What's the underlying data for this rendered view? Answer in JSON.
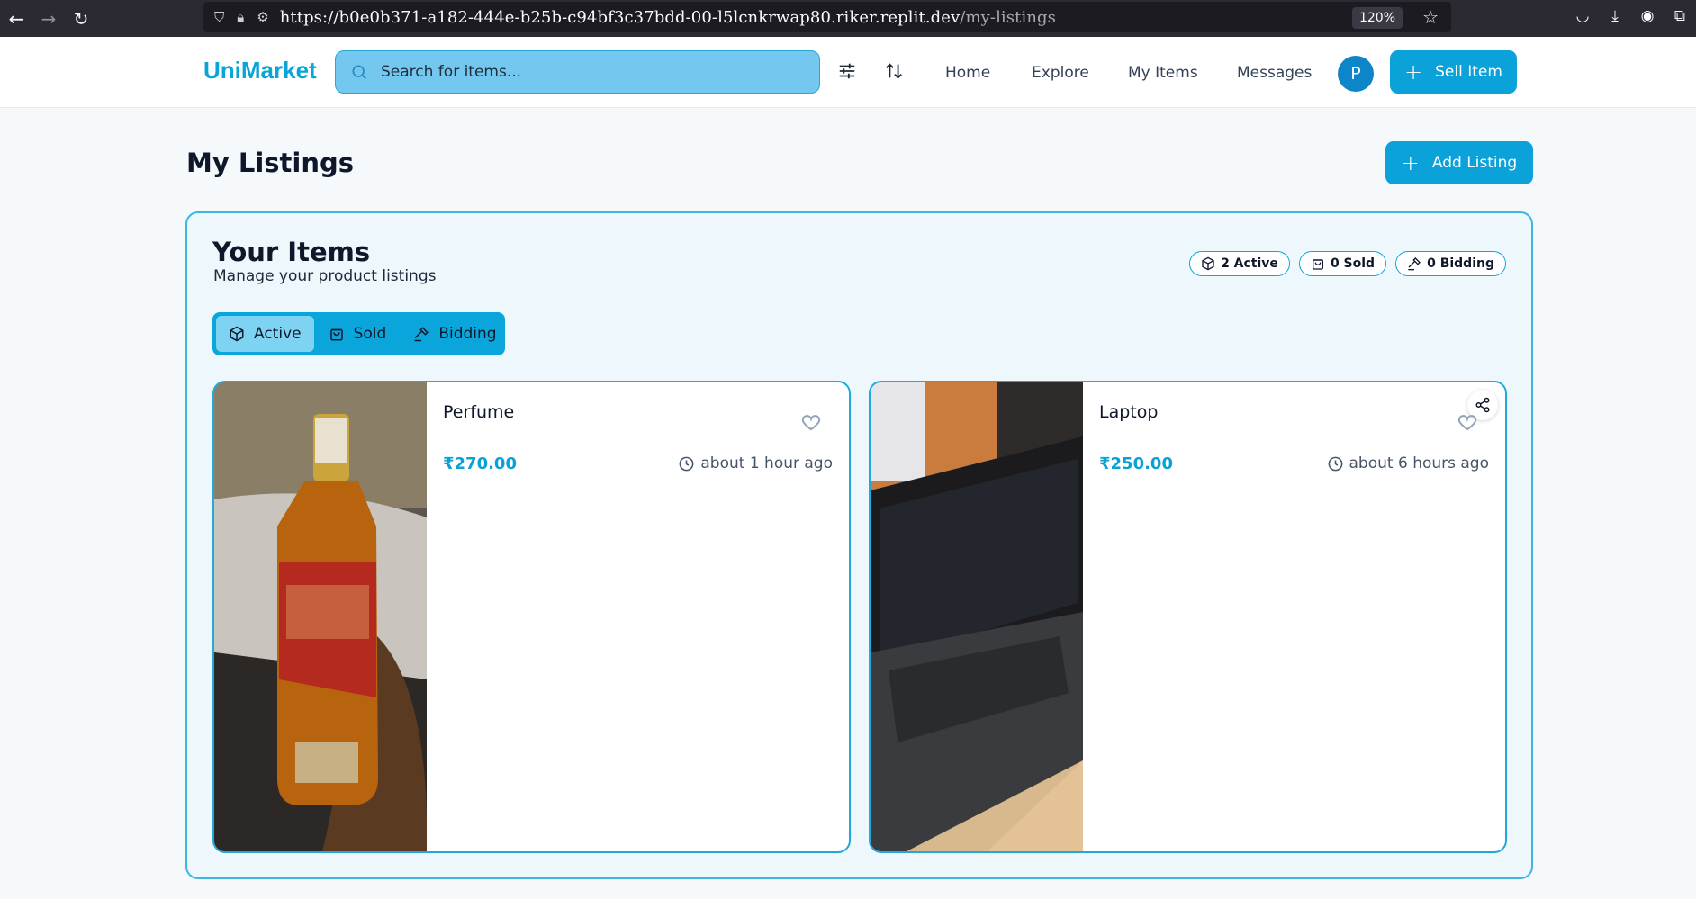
{
  "browser": {
    "url_main": "https://b0e0b371-a182-444e-b25b-c94bf3c37bdd-00-l5lcnkrwap80.riker.replit.dev",
    "url_path": "/my-listings",
    "zoom": "120%"
  },
  "header": {
    "logo": "UniMarket",
    "search_placeholder": "Search for items...",
    "nav": [
      "Home",
      "Explore",
      "My Items",
      "Messages"
    ],
    "avatar_initial": "P",
    "sell_label": "Sell Item"
  },
  "page": {
    "title": "My Listings",
    "add_label": "Add Listing"
  },
  "panel": {
    "title": "Your Items",
    "subtitle": "Manage your product listings",
    "badges": {
      "active": "2 Active",
      "sold": "0 Sold",
      "bidding": "0 Bidding"
    },
    "tabs": {
      "active": "Active",
      "sold": "Sold",
      "bidding": "Bidding"
    }
  },
  "listings": [
    {
      "name": "Perfume",
      "price": "₹270.00",
      "time": "about 1 hour ago"
    },
    {
      "name": "Laptop",
      "price": "₹250.00",
      "time": "about 6 hours ago"
    }
  ],
  "colors": {
    "brand": "#0aa5d8",
    "primary_button": "#0ba1d9",
    "price": "#0aa1d6"
  }
}
